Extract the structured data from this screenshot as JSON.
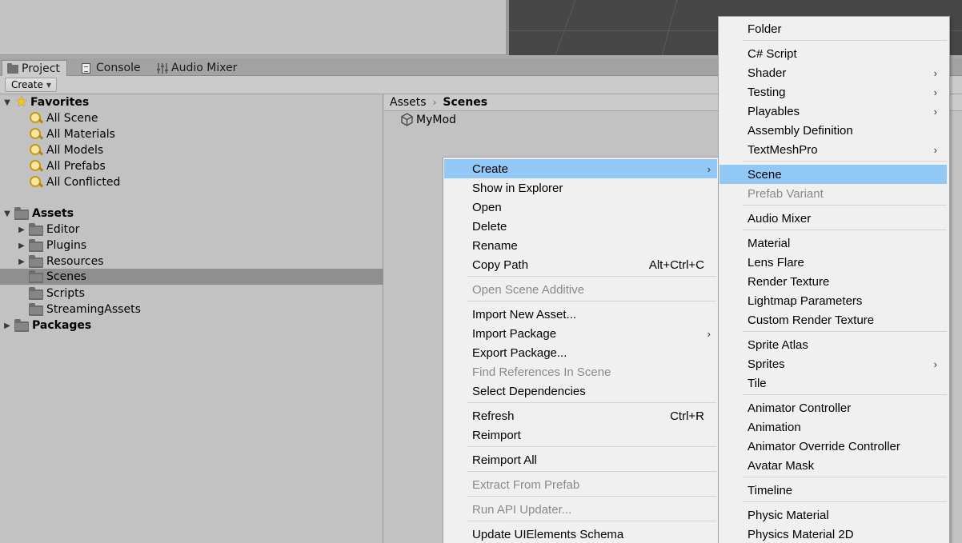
{
  "tabs": [
    {
      "label": "Project",
      "icon": "folder-icon",
      "active": true
    },
    {
      "label": "Console",
      "icon": "console-icon",
      "active": false
    },
    {
      "label": "Audio Mixer",
      "icon": "audio-mixer-icon",
      "active": false
    }
  ],
  "toolbar": {
    "create_label": "Create"
  },
  "tree": {
    "favorites_label": "Favorites",
    "favorites": [
      "All Scene",
      "All Materials",
      "All Models",
      "All Prefabs",
      "All Conflicted"
    ],
    "assets_label": "Assets",
    "assets_children": [
      "Editor",
      "Plugins",
      "Resources",
      "Scenes",
      "Scripts",
      "StreamingAssets"
    ],
    "selected": "Scenes",
    "packages_label": "Packages"
  },
  "breadcrumb": {
    "root": "Assets",
    "current": "Scenes"
  },
  "assets_list": [
    {
      "name": "MyMod",
      "icon": "unity-scene-icon"
    }
  ],
  "context_menu": {
    "items": [
      {
        "label": "Create",
        "submenu": true,
        "highlight": true
      },
      {
        "label": "Show in Explorer"
      },
      {
        "label": "Open"
      },
      {
        "label": "Delete"
      },
      {
        "label": "Rename"
      },
      {
        "label": "Copy Path",
        "shortcut": "Alt+Ctrl+C"
      },
      {
        "label": "Open Scene Additive",
        "disabled": true
      },
      {
        "label": "Import New Asset..."
      },
      {
        "label": "Import Package",
        "submenu": true
      },
      {
        "label": "Export Package..."
      },
      {
        "label": "Find References In Scene",
        "disabled": true
      },
      {
        "label": "Select Dependencies"
      },
      {
        "label": "Refresh",
        "shortcut": "Ctrl+R"
      },
      {
        "label": "Reimport"
      },
      {
        "label": "Reimport All"
      },
      {
        "label": "Extract From Prefab",
        "disabled": true
      },
      {
        "label": "Run API Updater...",
        "disabled": true
      },
      {
        "label": "Update UIElements Schema"
      }
    ]
  },
  "create_submenu": {
    "items": [
      {
        "label": "Folder"
      },
      {
        "label": "C# Script"
      },
      {
        "label": "Shader",
        "submenu": true
      },
      {
        "label": "Testing",
        "submenu": true
      },
      {
        "label": "Playables",
        "submenu": true
      },
      {
        "label": "Assembly Definition"
      },
      {
        "label": "TextMeshPro",
        "submenu": true
      },
      {
        "label": "Scene",
        "highlight": true
      },
      {
        "label": "Prefab Variant",
        "disabled": true
      },
      {
        "label": "Audio Mixer"
      },
      {
        "label": "Material"
      },
      {
        "label": "Lens Flare"
      },
      {
        "label": "Render Texture"
      },
      {
        "label": "Lightmap Parameters"
      },
      {
        "label": "Custom Render Texture"
      },
      {
        "label": "Sprite Atlas"
      },
      {
        "label": "Sprites",
        "submenu": true
      },
      {
        "label": "Tile"
      },
      {
        "label": "Animator Controller"
      },
      {
        "label": "Animation"
      },
      {
        "label": "Animator Override Controller"
      },
      {
        "label": "Avatar Mask"
      },
      {
        "label": "Timeline"
      },
      {
        "label": "Physic Material"
      },
      {
        "label": "Physics Material 2D"
      }
    ]
  },
  "colors": {
    "highlight": "#92c8f6",
    "menu_bg": "#f0f0f0",
    "panel_bg": "#c2c2c2",
    "scene_bg": "#474747"
  }
}
